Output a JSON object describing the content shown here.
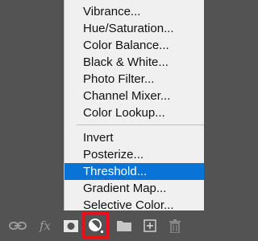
{
  "menu": {
    "group1": [
      {
        "label": "Vibrance..."
      },
      {
        "label": "Hue/Saturation..."
      },
      {
        "label": "Color Balance..."
      },
      {
        "label": "Black & White..."
      },
      {
        "label": "Photo Filter..."
      },
      {
        "label": "Channel Mixer..."
      },
      {
        "label": "Color Lookup..."
      }
    ],
    "group2": [
      {
        "label": "Invert"
      },
      {
        "label": "Posterize..."
      },
      {
        "label": "Threshold...",
        "selected": true
      },
      {
        "label": "Gradient Map..."
      },
      {
        "label": "Selective Color..."
      }
    ]
  },
  "toolbar": {
    "fx_label": "fx",
    "icons": [
      "link-icon",
      "fx-icon",
      "mask-icon",
      "adjustment-layer-icon",
      "folder-icon",
      "new-layer-icon",
      "trash-icon"
    ]
  },
  "colors": {
    "panel_bg": "#535353",
    "menu_bg": "#f0f0f0",
    "selection": "#0a74d6",
    "highlight": "#e8101b"
  }
}
